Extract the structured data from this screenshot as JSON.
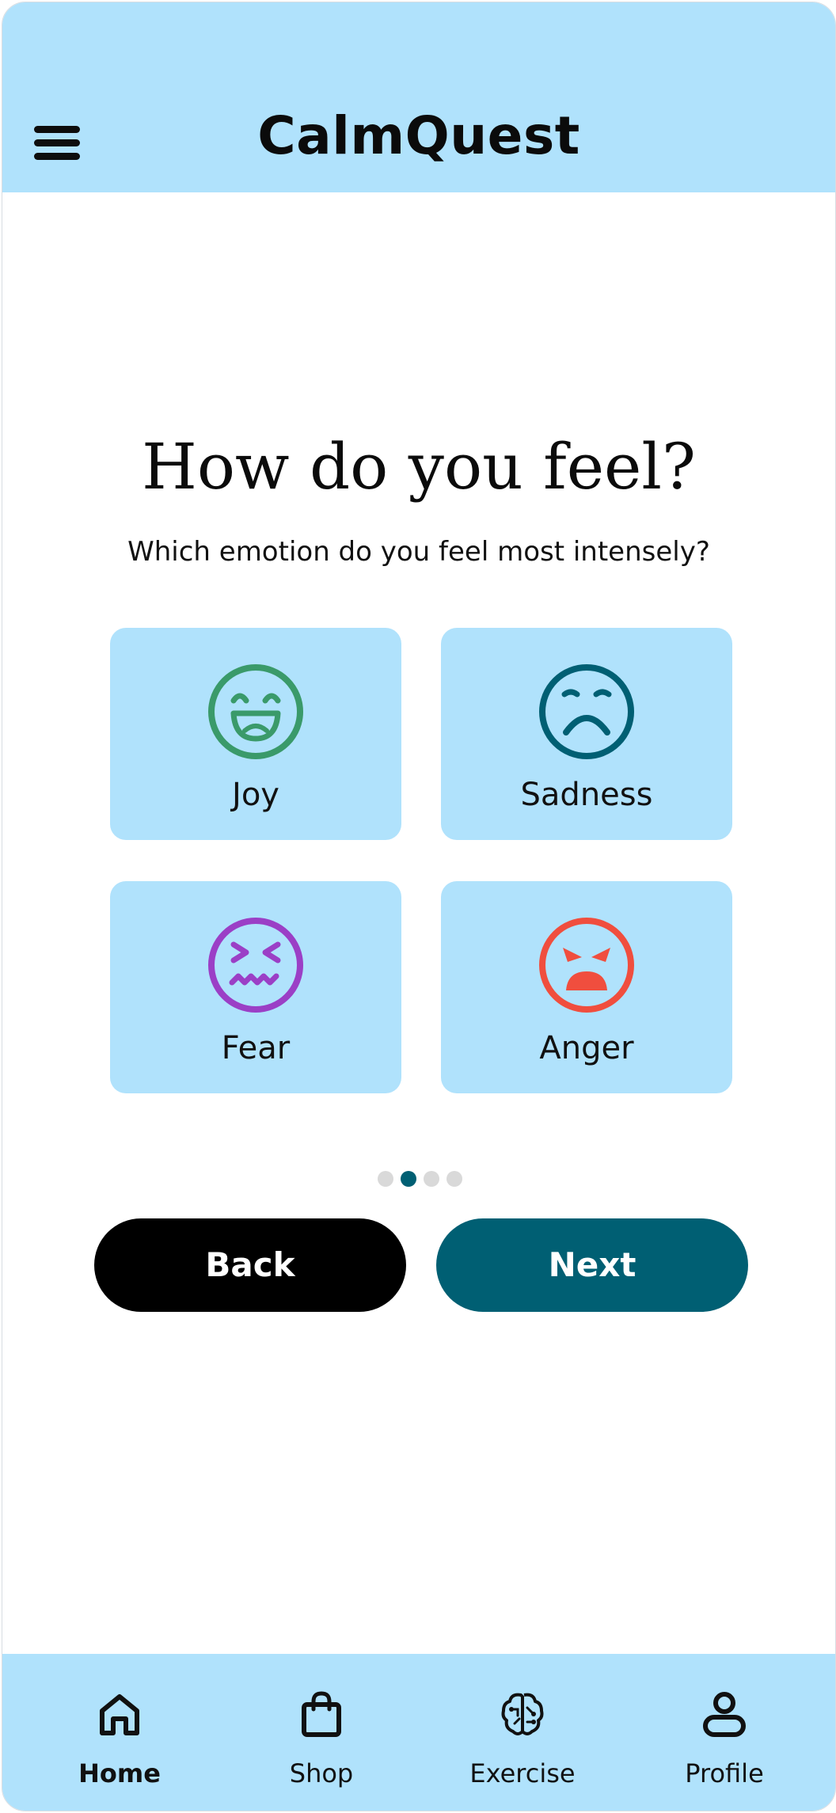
{
  "header": {
    "app_title": "CalmQuest",
    "menu_icon": "hamburger-menu-icon"
  },
  "question": {
    "title": "How do you feel?",
    "subtitle": "Which emotion do you feel most intensely?"
  },
  "emotions": [
    {
      "label": "Joy",
      "icon": "joy-face-icon",
      "color": "#3a9a6a"
    },
    {
      "label": "Sadness",
      "icon": "sad-face-icon",
      "color": "#005f73"
    },
    {
      "label": "Fear",
      "icon": "fear-face-icon",
      "color": "#9b3fc6"
    },
    {
      "label": "Anger",
      "icon": "angry-face-icon",
      "color": "#f04e3e"
    }
  ],
  "pagination": {
    "total": 4,
    "current": 2
  },
  "buttons": {
    "back_label": "Back",
    "next_label": "Next"
  },
  "bottom_nav": {
    "items": [
      {
        "label": "Home",
        "icon": "home-icon",
        "active": true
      },
      {
        "label": "Shop",
        "icon": "shopping-bag-icon",
        "active": false
      },
      {
        "label": "Exercise",
        "icon": "brain-icon",
        "active": false
      },
      {
        "label": "Profile",
        "icon": "profile-icon",
        "active": false
      }
    ]
  },
  "colors": {
    "header_bg": "#b0e2fc",
    "card_bg": "#b0e2fc",
    "primary": "#005f73",
    "back_button": "#000000"
  }
}
